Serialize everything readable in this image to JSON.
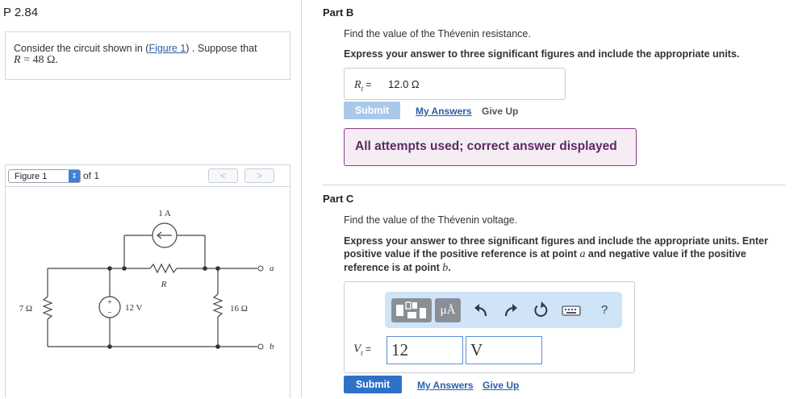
{
  "problem": {
    "id": "P 2.84"
  },
  "statement": {
    "text_before": "Consider the circuit shown in (",
    "figure_link": "Figure 1",
    "text_after": ") . Suppose that",
    "r_var": "R",
    "r_value": " = 48 Ω."
  },
  "figure_panel": {
    "select_value": "Figure 1",
    "of_text": "of 1",
    "prev_glyph": "<",
    "next_glyph": ">",
    "circuit": {
      "current_source_label": "1 A",
      "resistor_r_label": "R",
      "resistor_7_label": "7 Ω",
      "voltage_source_label": "12 V",
      "plus_sign": "+",
      "minus_sign": "−",
      "resistor_16_label": "16 Ω",
      "terminal_a": "a",
      "terminal_b": "b"
    }
  },
  "part_b": {
    "title": "Part B",
    "prompt": "Find the value of the Thévenin resistance.",
    "instruction": "Express your answer to three significant figures and include the appropriate units.",
    "answer_label_var": "R",
    "answer_label_sub": "t",
    "answer_label_eq": " =",
    "answer_value": "12.0 Ω",
    "submit_label": "Submit",
    "my_answers_label": "My Answers",
    "give_up_label": "Give Up",
    "status_message": "All attempts used; correct answer displayed",
    "colors": {
      "submit_disabled": "#a9c9ea",
      "status_border": "#8c3a8a",
      "status_bg": "#f5ecf4"
    }
  },
  "part_c": {
    "title": "Part C",
    "prompt": "Find the value of the Thévenin voltage.",
    "instruction_1": "Express your answer to three significant figures and include the appropriate units. Enter positive value if the positive reference is at point ",
    "point_a": "a",
    "instruction_2": " and negative value if the positive reference is at point ",
    "point_b": "b",
    "instruction_3": ".",
    "toolbar": {
      "icons": [
        "templates-icon",
        "units-icon",
        "undo-icon",
        "redo-icon",
        "reset-icon",
        "keyboard-icon",
        "help-icon"
      ],
      "units_glyph": "μÅ",
      "help_glyph": "?"
    },
    "answer_label_var": "V",
    "answer_label_sub": "t",
    "answer_label_eq": " =",
    "value_input": "12",
    "unit_input": "V",
    "submit_label": "Submit",
    "my_answers_label": "My Answers",
    "give_up_label": "Give Up",
    "colors": {
      "submit": "#2e71c8",
      "toolbar_bg": "#cfe4f7",
      "link": "#2b5ea7"
    }
  }
}
